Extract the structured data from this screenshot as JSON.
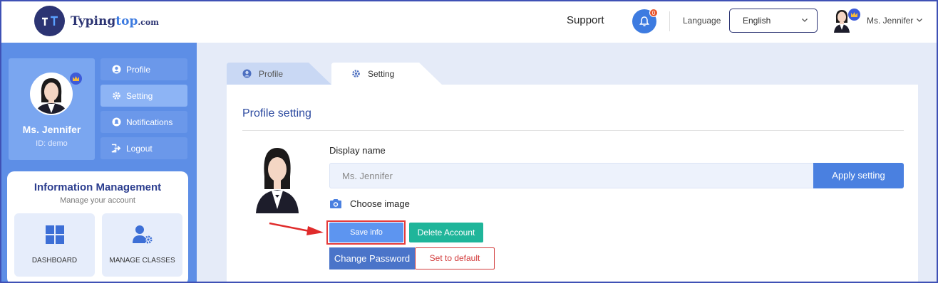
{
  "header": {
    "logo_main": "Typing",
    "logo_accent": "top",
    "logo_suffix": ".com",
    "support_label": "Support",
    "notification_count": "0",
    "language_label": "Language",
    "language_value": "English",
    "user_name": "Ms. Jennifer"
  },
  "sidebar": {
    "profile_name": "Ms. Jennifer",
    "profile_id": "ID: demo",
    "menu": [
      {
        "label": "Profile"
      },
      {
        "label": "Setting"
      },
      {
        "label": "Notifications"
      },
      {
        "label": "Logout"
      }
    ],
    "info_title": "Information Management",
    "info_subtitle": "Manage your account",
    "tiles": [
      {
        "label": "DASHBOARD"
      },
      {
        "label": "MANAGE CLASSES"
      }
    ]
  },
  "tabs": [
    {
      "label": "Profile"
    },
    {
      "label": "Setting"
    }
  ],
  "profile_setting": {
    "title": "Profile setting",
    "display_name_label": "Display name",
    "display_name_value": "Ms. Jennifer",
    "apply_label": "Apply setting",
    "choose_image_label": "Choose image",
    "save_label": "Save info",
    "delete_label": "Delete Account",
    "change_password_label": "Change Password",
    "default_label": "Set to default"
  },
  "colors": {
    "brand_dark": "#2c3473",
    "brand_blue": "#3d7be0",
    "sidebar_bg": "#5d8ee6",
    "delete_green": "#1fb59a",
    "highlight_red": "#e53b3b"
  }
}
